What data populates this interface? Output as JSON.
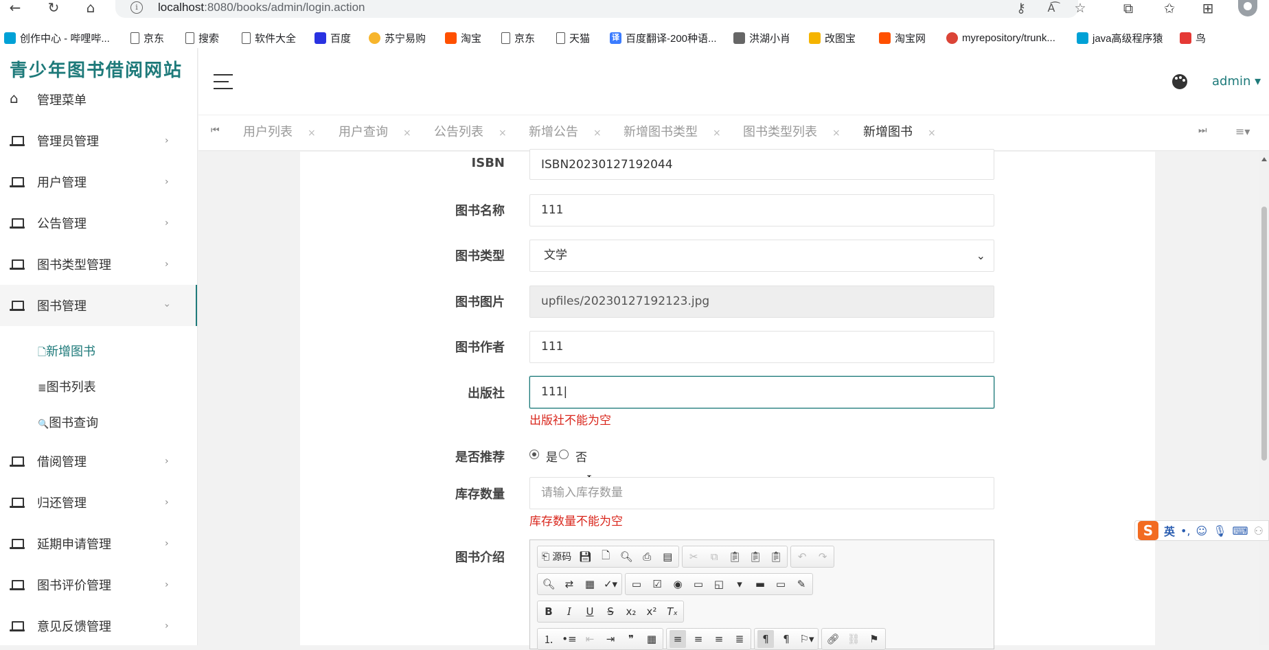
{
  "browser": {
    "url_host": "localhost",
    "url_path": ":8080/books/admin/login.action",
    "bookmarks": [
      {
        "label": "创作中心 - 哔哩哔...",
        "icon": "bilibili-icon",
        "color": "#00a1d6"
      },
      {
        "label": "京东",
        "icon": "page-icon"
      },
      {
        "label": "搜索",
        "icon": "page-icon"
      },
      {
        "label": "软件大全",
        "icon": "page-icon"
      },
      {
        "label": "百度",
        "icon": "baidu-icon",
        "color": "#2932e1"
      },
      {
        "label": "苏宁易购",
        "icon": "suning-icon",
        "color": "#f7b52c"
      },
      {
        "label": "淘宝",
        "icon": "taobao-icon",
        "color": "#ff5000"
      },
      {
        "label": "京东",
        "icon": "page-icon"
      },
      {
        "label": "天猫",
        "icon": "page-icon"
      },
      {
        "label": "百度翻译-200种语...",
        "icon": "translate-icon",
        "color": "#3b7cff"
      },
      {
        "label": "洪湖小肖",
        "icon": "bird-icon",
        "color": "#666666"
      },
      {
        "label": "改图宝",
        "icon": "gaitubao-icon",
        "color": "#f5b400"
      },
      {
        "label": "淘宝网",
        "icon": "taobao-icon",
        "color": "#ff5000"
      },
      {
        "label": "myrepository/trunk...",
        "icon": "chrome-icon",
        "color": "#db4437"
      },
      {
        "label": "java高级程序猿",
        "icon": "bilibili-icon",
        "color": "#00a1d6"
      },
      {
        "label": "鸟",
        "icon": "bird-icon",
        "color": "#e53935"
      }
    ]
  },
  "app": {
    "title": "青少年图书借阅网站",
    "user": "admin ▾",
    "accent": "#1e7a7a"
  },
  "sidebar": {
    "home": "管理菜单",
    "items": [
      {
        "label": "管理员管理"
      },
      {
        "label": "用户管理"
      },
      {
        "label": "公告管理"
      },
      {
        "label": "图书类型管理"
      },
      {
        "label": "图书管理"
      },
      {
        "label": "借阅管理"
      },
      {
        "label": "归还管理"
      },
      {
        "label": "延期申请管理"
      },
      {
        "label": "图书评价管理"
      },
      {
        "label": "意见反馈管理"
      }
    ],
    "sub_items": [
      {
        "label": "新增图书",
        "icon": "file-icon"
      },
      {
        "label": "图书列表",
        "icon": "list-icon"
      },
      {
        "label": "图书查询",
        "icon": "search-icon"
      }
    ]
  },
  "tabs": [
    {
      "label": "用户列表"
    },
    {
      "label": "用户查询"
    },
    {
      "label": "公告列表"
    },
    {
      "label": "新增公告"
    },
    {
      "label": "新增图书类型"
    },
    {
      "label": "图书类型列表"
    },
    {
      "label": "新增图书"
    }
  ],
  "form": {
    "isbn": {
      "label": "ISBN",
      "value": "ISBN20230127192044"
    },
    "name": {
      "label": "图书名称",
      "value": "111"
    },
    "type": {
      "label": "图书类型",
      "value": "文学"
    },
    "image": {
      "label": "图书图片",
      "value": "upfiles/20230127192123.jpg"
    },
    "author": {
      "label": "图书作者",
      "value": "111"
    },
    "publisher": {
      "label": "出版社",
      "value": "111|",
      "error": "出版社不能为空"
    },
    "recommend": {
      "label": "是否推荐",
      "yes": "是",
      "no": "否",
      "selected": "是"
    },
    "stock": {
      "label": "库存数量",
      "placeholder": "请输入库存数量",
      "error": "库存数量不能为空"
    },
    "intro": {
      "label": "图书介绍",
      "source_btn": "源码"
    }
  },
  "ime": {
    "lang": "英"
  }
}
